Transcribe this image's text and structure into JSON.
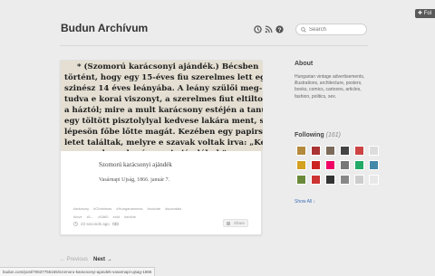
{
  "top": {
    "follow_label": "Fol"
  },
  "header": {
    "title": "Budun Archívum",
    "search_placeholder": "Search",
    "icons": [
      "history-icon",
      "rss-icon",
      "help-icon"
    ]
  },
  "post": {
    "title": "Szomorú karácsonyi ajándék",
    "caption": "Vasárnapi Ujság, 1866. január 7.",
    "tags": [
      "#advisory",
      "#Christmas",
      "#Hungarianness",
      "#suicide",
      "#scandals",
      "#love",
      "#1...",
      "#1860",
      "#old",
      "#article"
    ],
    "timestamp": "23 seconds ago",
    "share_label": "Share"
  },
  "sidebar": {
    "about_heading": "About",
    "about_text": "Hungarian vintage advertisements, illustrations, architecture, posters, books, comics, cartoons, articles, fashion, politics, sex.",
    "following_heading": "Following",
    "following_count": "(161)",
    "avatar_colors": [
      "#b48a3c",
      "#a33",
      "#7b6a5a",
      "#444",
      "#c44",
      "#ddd",
      "#d4a020",
      "#c22",
      "#e06",
      "#777",
      "#2a6",
      "#48a",
      "#6a8a3a",
      "#c33",
      "#333",
      "#888",
      "#ccc",
      "#e8e8e8"
    ],
    "show_all": "Show All ↓"
  },
  "pager": {
    "prev": "← Previous",
    "next": "Next →"
  },
  "status_url": "budun.com/post/70637755155/szomoru-karacsonyi-ajandek-vasarnapi-ujsag-1866"
}
